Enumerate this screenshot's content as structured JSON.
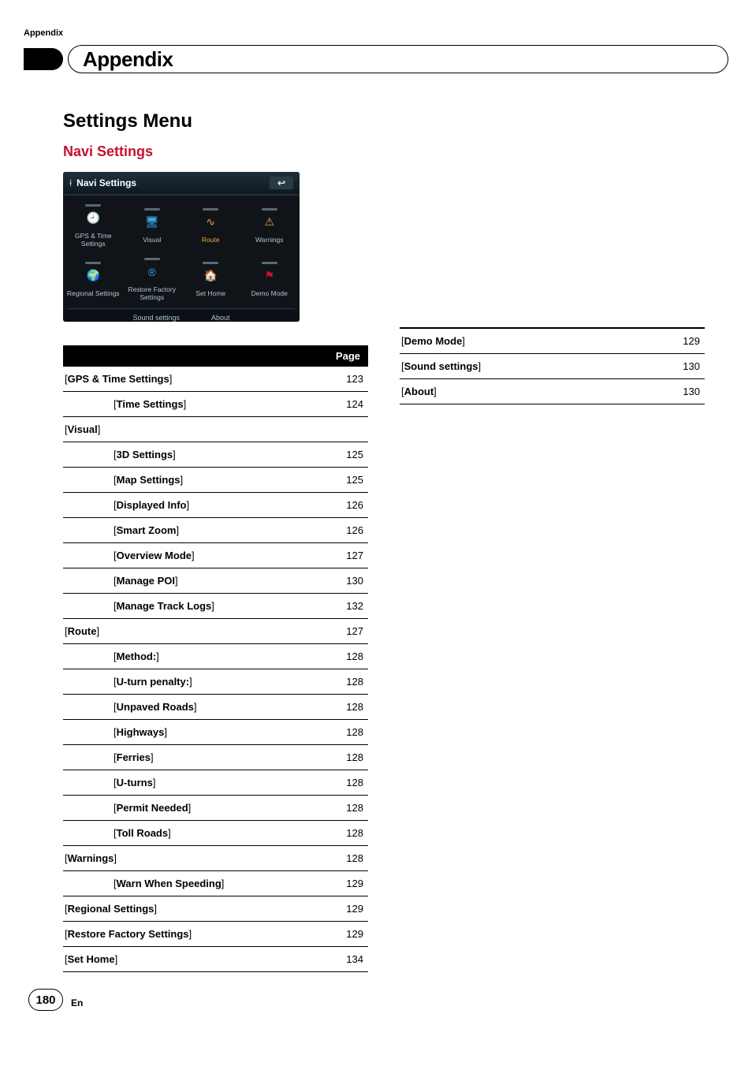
{
  "header_label": "Appendix",
  "page_title": "Appendix",
  "section_title": "Settings Menu",
  "subsection_title": "Navi Settings",
  "navi_screenshot": {
    "title": "Navi Settings",
    "items": [
      {
        "label": "GPS & Time Settings",
        "color": "#3aa4e6"
      },
      {
        "label": "Visual",
        "color": "#3aa4e6"
      },
      {
        "label": "Route",
        "color": "#f0a63c",
        "selected": true
      },
      {
        "label": "Warnings",
        "color": "#f0a63c"
      },
      {
        "label": "Regional Settings",
        "color": "#c4122f"
      },
      {
        "label": "Restore Factory Settings",
        "color": "#3aa4e6"
      },
      {
        "label": "Set Home",
        "color": "#7ab84a"
      },
      {
        "label": "Demo Mode",
        "color": "#c4122f"
      }
    ],
    "bottom_items": [
      "Sound settings",
      "About"
    ]
  },
  "table_header": "Page",
  "left_rows": [
    {
      "label": "GPS & Time Settings",
      "page": "123",
      "indent": 0
    },
    {
      "label": "Time Settings",
      "page": "124",
      "indent": 1
    },
    {
      "label": "Visual",
      "page": "",
      "indent": 0
    },
    {
      "label": "3D Settings",
      "page": "125",
      "indent": 1
    },
    {
      "label": "Map Settings",
      "page": "125",
      "indent": 1
    },
    {
      "label": "Displayed Info",
      "page": "126",
      "indent": 1
    },
    {
      "label": "Smart Zoom",
      "page": "126",
      "indent": 1
    },
    {
      "label": "Overview Mode",
      "page": "127",
      "indent": 1
    },
    {
      "label": "Manage POI",
      "page": "130",
      "indent": 1
    },
    {
      "label": "Manage Track Logs",
      "page": "132",
      "indent": 1
    },
    {
      "label": "Route",
      "page": "127",
      "indent": 0
    },
    {
      "label": "Method:",
      "page": "128",
      "indent": 1
    },
    {
      "label": "U-turn penalty:",
      "page": "128",
      "indent": 1
    },
    {
      "label": "Unpaved Roads",
      "page": "128",
      "indent": 1
    },
    {
      "label": "Highways",
      "page": "128",
      "indent": 1
    },
    {
      "label": "Ferries",
      "page": "128",
      "indent": 1
    },
    {
      "label": "U-turns",
      "page": "128",
      "indent": 1
    },
    {
      "label": "Permit Needed",
      "page": "128",
      "indent": 1
    },
    {
      "label": "Toll Roads",
      "page": "128",
      "indent": 1
    },
    {
      "label": "Warnings",
      "page": "128",
      "indent": 0
    },
    {
      "label": "Warn When Speeding",
      "page": "129",
      "indent": 1
    },
    {
      "label": "Regional Settings",
      "page": "129",
      "indent": 0
    },
    {
      "label": "Restore Factory Settings",
      "page": "129",
      "indent": 0
    },
    {
      "label": "Set Home",
      "page": "134",
      "indent": 0
    }
  ],
  "right_rows": [
    {
      "label": "Demo Mode",
      "page": "129",
      "indent": 0
    },
    {
      "label": "Sound settings",
      "page": "130",
      "indent": 0
    },
    {
      "label": "About",
      "page": "130",
      "indent": 0
    }
  ],
  "page_number": "180",
  "lang": "En"
}
